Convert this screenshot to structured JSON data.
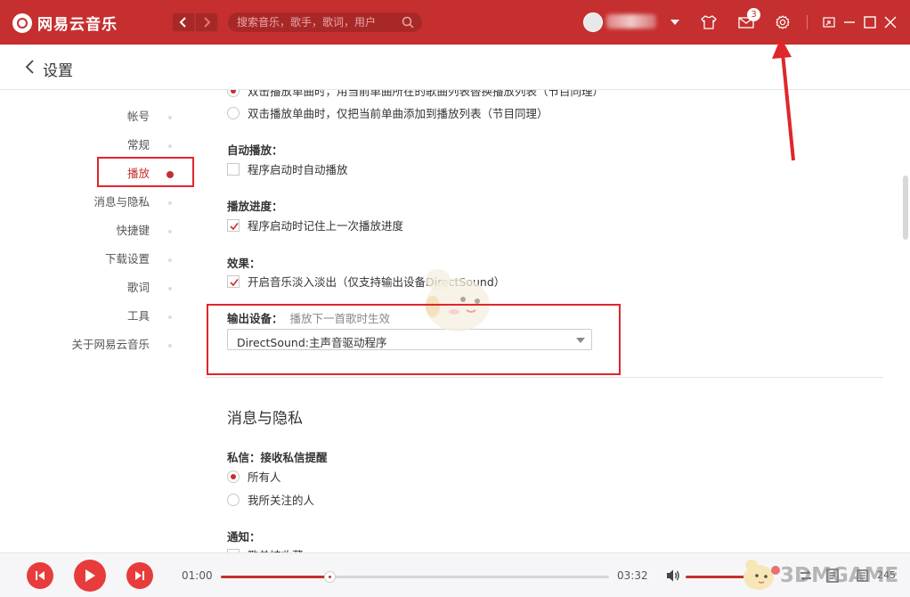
{
  "app": {
    "name": "网易云音乐",
    "brand_color": "#c62f2f"
  },
  "titlebar": {
    "search_placeholder": "搜索音乐，歌手，歌词，用户",
    "mail_badge": "3",
    "icons": [
      "back-icon",
      "forward-icon",
      "search-icon",
      "skin-icon",
      "mail-icon",
      "settings-icon",
      "mini-mode-icon",
      "minimize-icon",
      "maximize-icon",
      "close-icon"
    ]
  },
  "page": {
    "title": "设置"
  },
  "sidebar": {
    "items": [
      {
        "label": "帐号"
      },
      {
        "label": "常规"
      },
      {
        "label": "播放"
      },
      {
        "label": "消息与隐私"
      },
      {
        "label": "快捷键"
      },
      {
        "label": "下载设置"
      },
      {
        "label": "歌词"
      },
      {
        "label": "工具"
      },
      {
        "label": "关于网易云音乐"
      }
    ],
    "active_index": 2
  },
  "settings": {
    "playback_mode": {
      "options": [
        "双击播放单曲时，用当前单曲所在的歌曲列表替换播放列表（节目同理）",
        "双击播放单曲时，仅把当前单曲添加到播放列表（节目同理）"
      ],
      "selected": 0
    },
    "autoplay": {
      "label": "自动播放：",
      "option": "程序启动时自动播放",
      "checked": false
    },
    "progress": {
      "label": "播放进度：",
      "option": "程序启动时记住上一次播放进度",
      "checked": true
    },
    "effects": {
      "label": "效果：",
      "option": "开启音乐淡入淡出（仅支持输出设备DirectSound）",
      "checked": true
    },
    "output": {
      "label": "输出设备：",
      "hint": "播放下一首歌时生效",
      "selected_value": "DirectSound:主声音驱动程序"
    }
  },
  "privacy": {
    "section_title": "消息与隐私",
    "private_message": {
      "label": "私信：",
      "hint": "接收私信提醒",
      "options": [
        "所有人",
        "我所关注的人"
      ],
      "selected": 0
    },
    "notify": {
      "label": "通知：",
      "option": "歌单被收藏",
      "checked": true
    }
  },
  "player": {
    "current_time": "01:00",
    "total_time": "03:32",
    "progress": 0.28,
    "volume": 1.0,
    "playlist_count": "245",
    "watermark": "3DMGAME"
  }
}
